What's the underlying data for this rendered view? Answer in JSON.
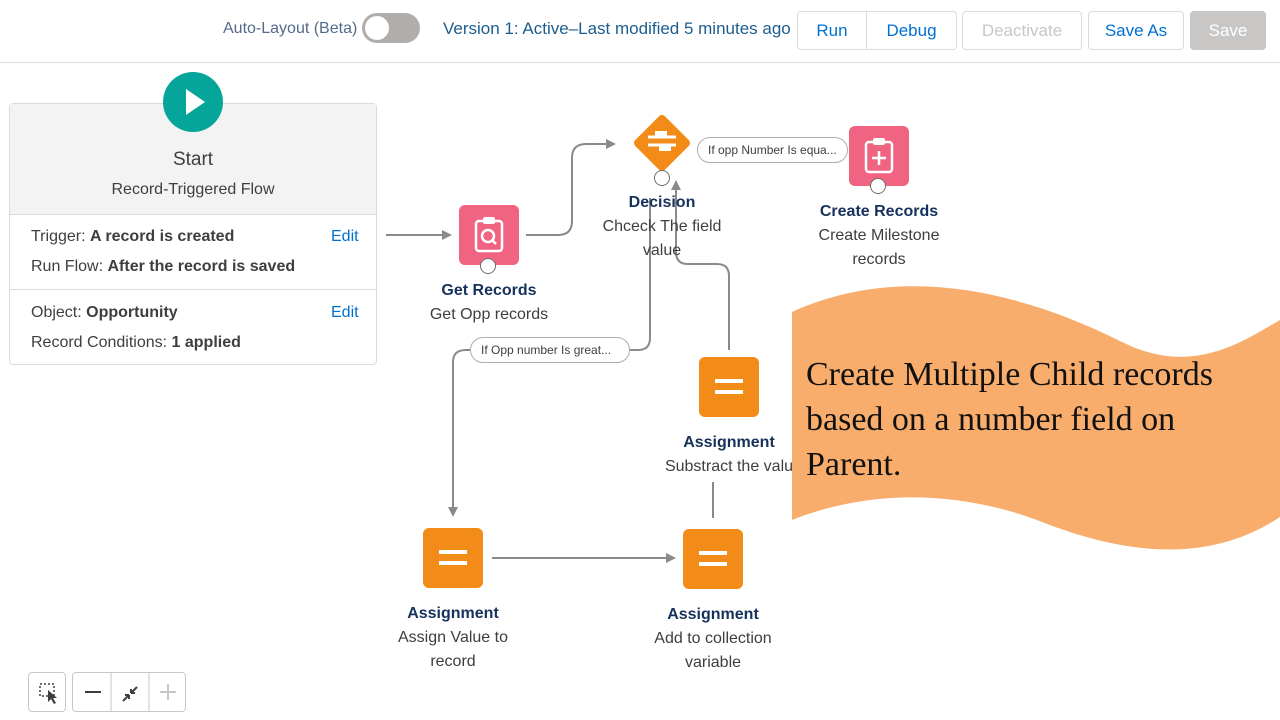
{
  "toolbar": {
    "auto_layout_label": "Auto-Layout (Beta)",
    "version_text": "Version 1: Active–Last modified 5 minutes ago",
    "run_label": "Run",
    "debug_label": "Debug",
    "deactivate_label": "Deactivate",
    "save_as_label": "Save As",
    "save_label": "Save"
  },
  "start": {
    "title": "Start",
    "subtitle": "Record-Triggered Flow",
    "trigger_label": "Trigger:",
    "trigger_value": "A record is created",
    "run_flow_label": "Run Flow:",
    "run_flow_value": "After the record is saved",
    "object_label": "Object:",
    "object_value": "Opportunity",
    "conditions_label": "Record Conditions:",
    "conditions_value": "1 applied",
    "edit_label": "Edit"
  },
  "nodes": {
    "get_records": {
      "title": "Get Records",
      "sub": "Get Opp records"
    },
    "decision": {
      "title": "Decision",
      "sub1": "Chceck The field",
      "sub2": "value"
    },
    "create_records": {
      "title": "Create Records",
      "sub1": "Create Milestone",
      "sub2": "records"
    },
    "assign_subtract": {
      "title": "Assignment",
      "sub": "Substract the valu"
    },
    "assign_value": {
      "title": "Assignment",
      "sub1": "Assign Value to",
      "sub2": "record"
    },
    "assign_collection": {
      "title": "Assignment",
      "sub1": "Add to collection",
      "sub2": "variable"
    }
  },
  "connectors": {
    "equal_label": "If opp Number Is equa...",
    "greater_label": "If Opp number Is great..."
  },
  "banner": {
    "line1": "Create Multiple Child records",
    "line2": "based on a number field on",
    "line3": "Parent."
  },
  "colors": {
    "accent_blue": "#0070d2",
    "start_teal": "#06a59a",
    "records_pink": "#f06482",
    "logic_orange": "#f38b18",
    "banner_orange": "#f8ad6d"
  },
  "icons": {
    "start": "play-icon",
    "get_records": "search-record-icon",
    "create_records": "add-record-icon",
    "decision": "decision-icon",
    "assignment": "equals-icon"
  }
}
